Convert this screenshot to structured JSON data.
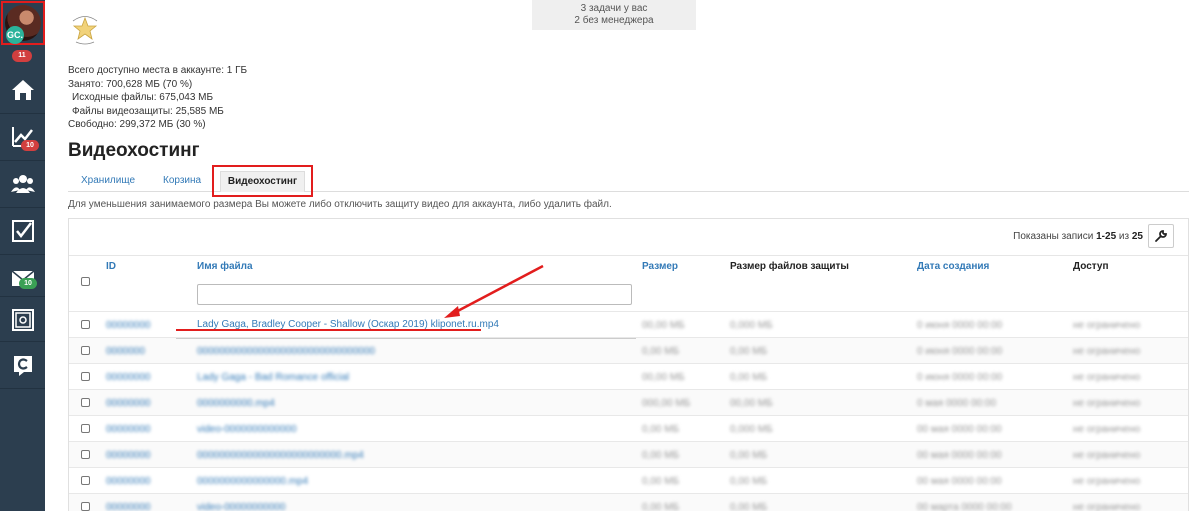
{
  "sidebar": {
    "avatar_initials": "GC.",
    "avatar_badge": "11",
    "items": [
      {
        "name": "home",
        "icon": "home-icon"
      },
      {
        "name": "stats",
        "icon": "chart-icon",
        "badge": "10",
        "badge_color": "#d23f3f"
      },
      {
        "name": "users",
        "icon": "users-icon"
      },
      {
        "name": "tasks",
        "icon": "checkbox-icon"
      },
      {
        "name": "mail",
        "icon": "mail-icon",
        "badge": "10",
        "badge_color": "#3aa055"
      },
      {
        "name": "safe",
        "icon": "safe-icon"
      },
      {
        "name": "app",
        "icon": "c-logo-icon"
      }
    ]
  },
  "tasks": {
    "line1": "3 задачи у вас",
    "line2": "2 без менеджера"
  },
  "storage": {
    "total": "Всего доступно места в аккаунте: 1 ГБ",
    "used": "Занято: 700,628 МБ (70 %)",
    "source": "Исходные файлы: 675,043 МБ",
    "protection": "Файлы видеозащиты: 25,585 МБ",
    "free": "Свободно: 299,372 МБ (30 %)"
  },
  "page_title": "Видеохостинг",
  "tabs": [
    {
      "label": "Хранилище"
    },
    {
      "label": "Корзина"
    },
    {
      "label": "Видеохостинг",
      "active": true
    }
  ],
  "hint": "Для уменьшения занимаемого размера Вы можете либо отключить защиту видео для аккаунта, либо удалить файл.",
  "records": {
    "prefix": "Показаны записи ",
    "range": "1-25",
    "middle": " из ",
    "total": "25"
  },
  "columns": {
    "id": "ID",
    "filename": "Имя файла",
    "size": "Размер",
    "protection_size": "Размер файлов защиты",
    "created": "Дата создания",
    "access": "Доступ"
  },
  "rows": [
    {
      "id": "00000000",
      "filename": "Lady Gaga, Bradley Cooper - Shallow (Оскар 2019) kliponet.ru.mp4",
      "size": "00,00 МБ",
      "protection": "0,000 МБ",
      "created": "0 июня 0000 00:00",
      "access": "не ограничено"
    },
    {
      "id": "0000000",
      "filename": "00000000000000000000000000000000",
      "size": "0,00 МБ",
      "protection": "0,00 МБ",
      "created": "0 июня 0000 00:00",
      "access": "не ограничено"
    },
    {
      "id": "00000000",
      "filename": "Lady Gaga - Bad Romance official",
      "size": "00,00 МБ",
      "protection": "0,00 МБ",
      "created": "0 июня 0000 00:00",
      "access": "не ограничено"
    },
    {
      "id": "00000000",
      "filename": "0000000000.mp4",
      "size": "000,00 МБ",
      "protection": "00,00 МБ",
      "created": "0 мая 0000 00:00",
      "access": "не ограничено"
    },
    {
      "id": "00000000",
      "filename": "video-0000000000000",
      "size": "0,00 МБ",
      "protection": "0,000 МБ",
      "created": "00 мая 0000 00:00",
      "access": "не ограничено"
    },
    {
      "id": "00000000",
      "filename": "00000000000000000000000000.mp4",
      "size": "0,00 МБ",
      "protection": "0,00 МБ",
      "created": "00 мая 0000 00:00",
      "access": "не ограничено"
    },
    {
      "id": "00000000",
      "filename": "0000000000000000.mp4",
      "size": "0,00 МБ",
      "protection": "0,00 МБ",
      "created": "00 мая 0000 00:00",
      "access": "не ограничено"
    },
    {
      "id": "00000000",
      "filename": "video-00000000000",
      "size": "0,00 МБ",
      "protection": "0,00 МБ",
      "created": "00 марта 0000 00:00",
      "access": "не ограничено"
    }
  ],
  "colors": {
    "sidebar_bg": "#2c3e4f",
    "link": "#337ab7",
    "highlight": "#e21d1d"
  }
}
